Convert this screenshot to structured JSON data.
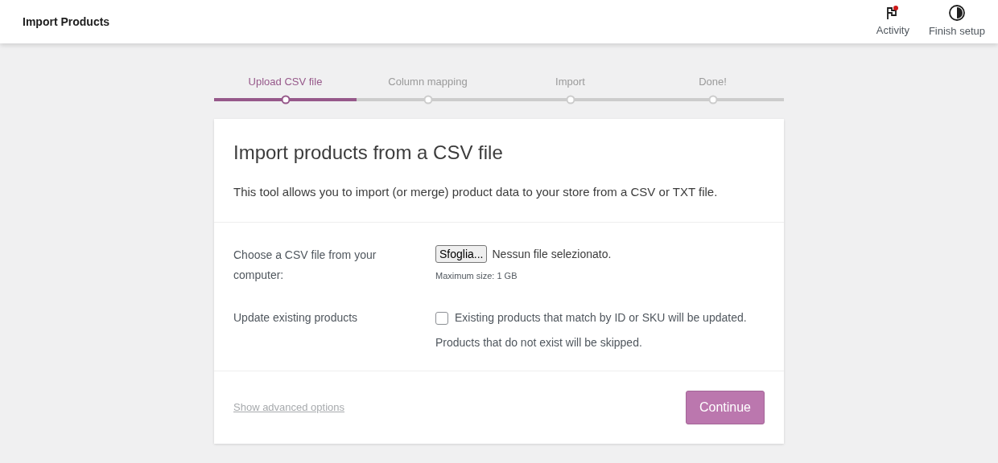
{
  "header": {
    "title": "Import Products",
    "actions": [
      {
        "kind": "activity",
        "label": "Activity"
      },
      {
        "kind": "setup",
        "label": "Finish setup"
      }
    ]
  },
  "steps": [
    {
      "label": "Upload CSV file",
      "selected": true
    },
    {
      "label": "Column mapping",
      "selected": false
    },
    {
      "label": "Import",
      "selected": false
    },
    {
      "label": "Done!",
      "selected": false
    }
  ],
  "card": {
    "title": "Import products from a CSV file",
    "description": "This tool allows you to import (or merge) product data to your store from a CSV or TXT file.",
    "file_row": {
      "label": "Choose a CSV file from your computer:",
      "button": "Sfoglia...",
      "status": "Nessun file selezionato.",
      "hint": "Maximum size: 1 GB"
    },
    "update_row": {
      "label": "Update existing products",
      "checkbox_label": "Existing products that match by ID or SKU will be updated.",
      "checked": false,
      "note": "Products that do not exist will be skipped."
    },
    "advanced_link": "Show advanced options",
    "continue_button": "Continue"
  }
}
